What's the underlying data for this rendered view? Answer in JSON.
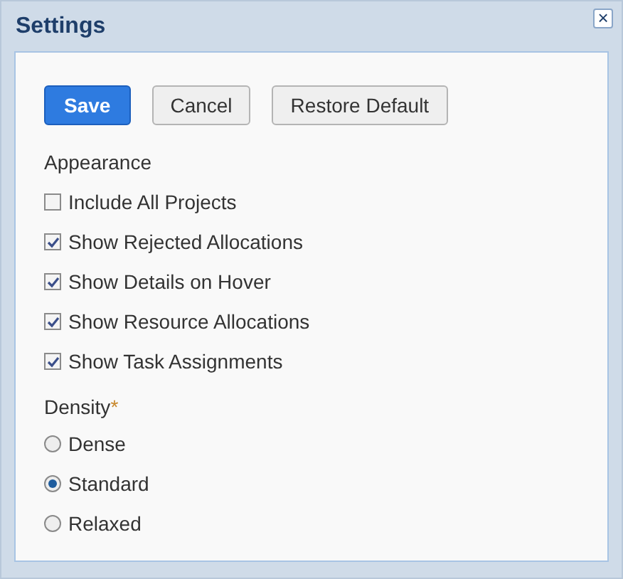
{
  "window": {
    "title": "Settings",
    "close": "×"
  },
  "buttons": [
    {
      "label": "Save",
      "kind": "primary"
    },
    {
      "label": "Cancel",
      "kind": "default"
    },
    {
      "label": "Restore Default",
      "kind": "default"
    }
  ],
  "appearance": {
    "label": "Appearance",
    "options": [
      {
        "label": "Include All Projects",
        "checked": false
      },
      {
        "label": "Show Rejected Allocations",
        "checked": true
      },
      {
        "label": "Show Details on Hover",
        "checked": true
      },
      {
        "label": "Show Resource Allocations",
        "checked": true
      },
      {
        "label": "Show Task Assignments",
        "checked": true
      }
    ]
  },
  "density": {
    "label": "Density",
    "required_mark": "*",
    "options": [
      {
        "label": "Dense",
        "selected": false
      },
      {
        "label": "Standard",
        "selected": true
      },
      {
        "label": "Relaxed",
        "selected": false
      }
    ]
  }
}
